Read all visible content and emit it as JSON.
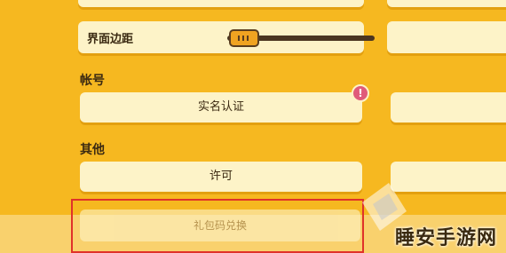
{
  "margin_setting": {
    "label": "界面边距",
    "value": "0"
  },
  "sections": {
    "account_label": "帐号",
    "other_label": "其他"
  },
  "buttons": {
    "real_name": "实名认证",
    "license": "许可",
    "gift_code": "礼包码兑换"
  },
  "alert_icon_text": "!",
  "watermark": "睡安手游网",
  "colors": {
    "background": "#f6b820",
    "panel": "#fdf3c8",
    "text": "#3b2a12",
    "alert": "#e05a7a",
    "highlight_border": "#e0322a"
  },
  "icons": [
    "alert-icon",
    "slider-grip-icon",
    "watermark-logo-icon"
  ]
}
